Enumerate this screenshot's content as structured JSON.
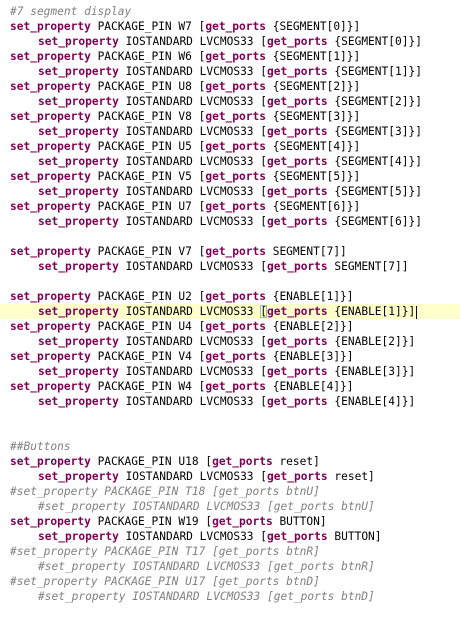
{
  "editor": {
    "lines": [
      {
        "type": "comment",
        "indent": false,
        "text": "#7 segment display"
      },
      {
        "type": "prop",
        "indent": false,
        "kw1": "set_property",
        "mid": " PACKAGE_PIN W7 [",
        "kw2": "get_ports",
        "tail": " {SEGMENT[0]}]"
      },
      {
        "type": "prop",
        "indent": true,
        "kw1": "set_property",
        "mid": " IOSTANDARD LVCMOS33 [",
        "kw2": "get_ports",
        "tail": " {SEGMENT[0]}]"
      },
      {
        "type": "prop",
        "indent": false,
        "kw1": "set_property",
        "mid": " PACKAGE_PIN W6 [",
        "kw2": "get_ports",
        "tail": " {SEGMENT[1]}]"
      },
      {
        "type": "prop",
        "indent": true,
        "kw1": "set_property",
        "mid": " IOSTANDARD LVCMOS33 [",
        "kw2": "get_ports",
        "tail": " {SEGMENT[1]}]"
      },
      {
        "type": "prop",
        "indent": false,
        "kw1": "set_property",
        "mid": " PACKAGE_PIN U8 [",
        "kw2": "get_ports",
        "tail": " {SEGMENT[2]}]"
      },
      {
        "type": "prop",
        "indent": true,
        "kw1": "set_property",
        "mid": " IOSTANDARD LVCMOS33 [",
        "kw2": "get_ports",
        "tail": " {SEGMENT[2]}]"
      },
      {
        "type": "prop",
        "indent": false,
        "kw1": "set_property",
        "mid": " PACKAGE_PIN V8 [",
        "kw2": "get_ports",
        "tail": " {SEGMENT[3]}]"
      },
      {
        "type": "prop",
        "indent": true,
        "kw1": "set_property",
        "mid": " IOSTANDARD LVCMOS33 [",
        "kw2": "get_ports",
        "tail": " {SEGMENT[3]}]"
      },
      {
        "type": "prop",
        "indent": false,
        "kw1": "set_property",
        "mid": " PACKAGE_PIN U5 [",
        "kw2": "get_ports",
        "tail": " {SEGMENT[4]}]"
      },
      {
        "type": "prop",
        "indent": true,
        "kw1": "set_property",
        "mid": " IOSTANDARD LVCMOS33 [",
        "kw2": "get_ports",
        "tail": " {SEGMENT[4]}]"
      },
      {
        "type": "prop",
        "indent": false,
        "kw1": "set_property",
        "mid": " PACKAGE_PIN V5 [",
        "kw2": "get_ports",
        "tail": " {SEGMENT[5]}]"
      },
      {
        "type": "prop",
        "indent": true,
        "kw1": "set_property",
        "mid": " IOSTANDARD LVCMOS33 [",
        "kw2": "get_ports",
        "tail": " {SEGMENT[5]}]"
      },
      {
        "type": "prop",
        "indent": false,
        "kw1": "set_property",
        "mid": " PACKAGE_PIN U7 [",
        "kw2": "get_ports",
        "tail": " {SEGMENT[6]}]"
      },
      {
        "type": "prop",
        "indent": true,
        "kw1": "set_property",
        "mid": " IOSTANDARD LVCMOS33 [",
        "kw2": "get_ports",
        "tail": " {SEGMENT[6]}]"
      },
      {
        "type": "blank"
      },
      {
        "type": "prop",
        "indent": false,
        "kw1": "set_property",
        "mid": " PACKAGE_PIN V7 [",
        "kw2": "get_ports",
        "tail": " SEGMENT[7]]"
      },
      {
        "type": "prop",
        "indent": true,
        "kw1": "set_property",
        "mid": " IOSTANDARD LVCMOS33 [",
        "kw2": "get_ports",
        "tail": " SEGMENT[7]]"
      },
      {
        "type": "blank"
      },
      {
        "type": "prop",
        "indent": false,
        "kw1": "set_property",
        "mid": " PACKAGE_PIN U2 [",
        "kw2": "get_ports",
        "tail": " {ENABLE[1]}]"
      },
      {
        "type": "prop",
        "indent": true,
        "current": true,
        "kw1": "set_property",
        "mid": " IOSTANDARD LVCMOS33 ",
        "bracket": "[",
        "kw2": "get_ports",
        "tail": " {ENABLE[1]}]"
      },
      {
        "type": "prop",
        "indent": false,
        "kw1": "set_property",
        "mid": " PACKAGE_PIN U4 [",
        "kw2": "get_ports",
        "tail": " {ENABLE[2]}]"
      },
      {
        "type": "prop",
        "indent": true,
        "kw1": "set_property",
        "mid": " IOSTANDARD LVCMOS33 [",
        "kw2": "get_ports",
        "tail": " {ENABLE[2]}]"
      },
      {
        "type": "prop",
        "indent": false,
        "kw1": "set_property",
        "mid": " PACKAGE_PIN V4 [",
        "kw2": "get_ports",
        "tail": " {ENABLE[3]}]"
      },
      {
        "type": "prop",
        "indent": true,
        "kw1": "set_property",
        "mid": " IOSTANDARD LVCMOS33 [",
        "kw2": "get_ports",
        "tail": " {ENABLE[3]}]"
      },
      {
        "type": "prop",
        "indent": false,
        "kw1": "set_property",
        "mid": " PACKAGE_PIN W4 [",
        "kw2": "get_ports",
        "tail": " {ENABLE[4]}]"
      },
      {
        "type": "prop",
        "indent": true,
        "kw1": "set_property",
        "mid": " IOSTANDARD LVCMOS33 [",
        "kw2": "get_ports",
        "tail": " {ENABLE[4]}]"
      },
      {
        "type": "blank"
      },
      {
        "type": "blank"
      },
      {
        "type": "comment",
        "indent": false,
        "text": "##Buttons"
      },
      {
        "type": "prop",
        "indent": false,
        "kw1": "set_property",
        "mid": " PACKAGE_PIN U18 [",
        "kw2": "get_ports",
        "tail": " reset]"
      },
      {
        "type": "prop",
        "indent": true,
        "kw1": "set_property",
        "mid": " IOSTANDARD LVCMOS33 [",
        "kw2": "get_ports",
        "tail": " reset]"
      },
      {
        "type": "comment",
        "indent": false,
        "text": "#set_property PACKAGE_PIN T18 [get_ports btnU]"
      },
      {
        "type": "comment",
        "indent": true,
        "text": "#set_property IOSTANDARD LVCMOS33 [get_ports btnU]"
      },
      {
        "type": "prop",
        "indent": false,
        "kw1": "set_property",
        "mid": " PACKAGE_PIN W19 [",
        "kw2": "get_ports",
        "tail": " BUTTON]"
      },
      {
        "type": "prop",
        "indent": true,
        "kw1": "set_property",
        "mid": " IOSTANDARD LVCMOS33 [",
        "kw2": "get_ports",
        "tail": " BUTTON]"
      },
      {
        "type": "comment",
        "indent": false,
        "text": "#set_property PACKAGE_PIN T17 [get_ports btnR]"
      },
      {
        "type": "comment",
        "indent": true,
        "text": "#set_property IOSTANDARD LVCMOS33 [get_ports btnR]"
      },
      {
        "type": "comment",
        "indent": false,
        "text": "#set_property PACKAGE_PIN U17 [get_ports btnD]"
      },
      {
        "type": "comment",
        "indent": true,
        "text": "#set_property IOSTANDARD LVCMOS33 [get_ports btnD]"
      }
    ]
  }
}
